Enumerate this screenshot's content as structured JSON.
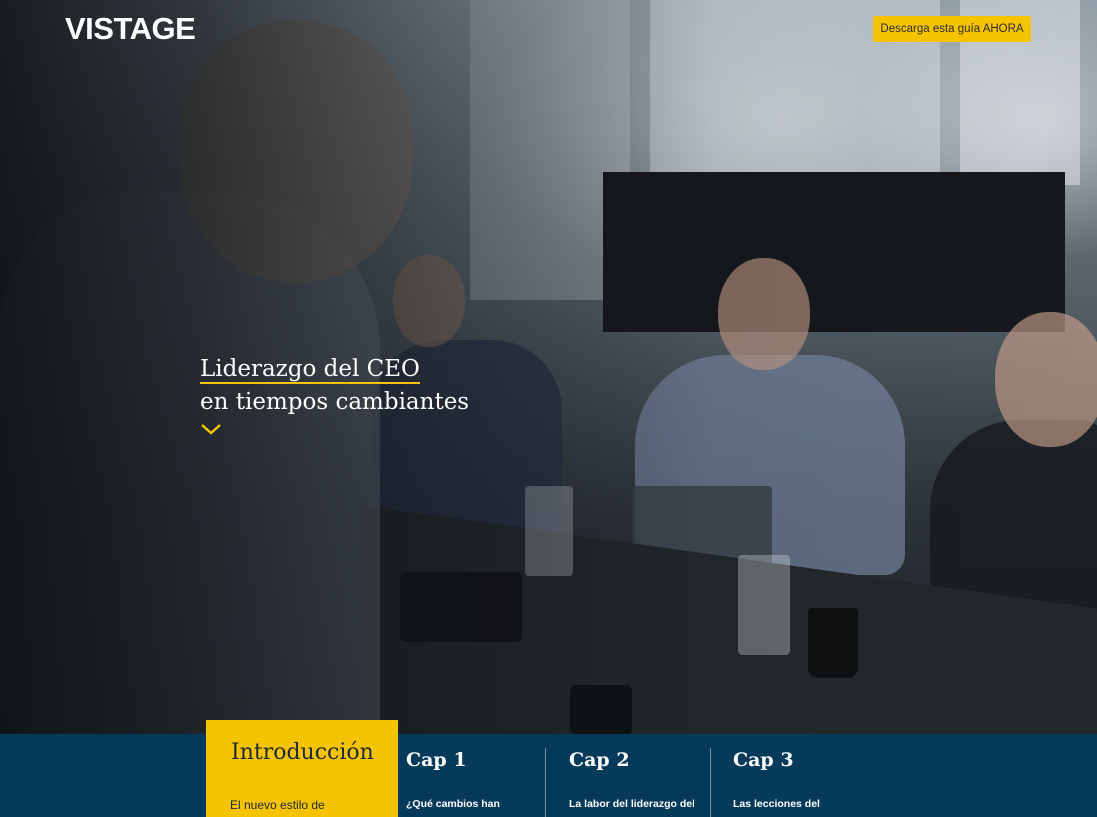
{
  "header": {
    "logo": "VISTAGE",
    "cta_label": "Descarga esta guía AHORA"
  },
  "hero": {
    "title_line1": "Liderazgo del CEO",
    "title_line2": "en tiempos cambiantes",
    "scroll_icon": "chevron-down-icon"
  },
  "chapters": [
    {
      "title": "Introducción",
      "desc": "El nuevo estilo de"
    },
    {
      "title": "Cap 1",
      "desc": "¿Qué cambios han"
    },
    {
      "title": "Cap 2",
      "desc": "La labor del liderazgo del"
    },
    {
      "title": "Cap 3",
      "desc": "Las lecciones del"
    }
  ],
  "colors": {
    "accent": "#f5c300",
    "nav_bg": "#063a5b"
  }
}
